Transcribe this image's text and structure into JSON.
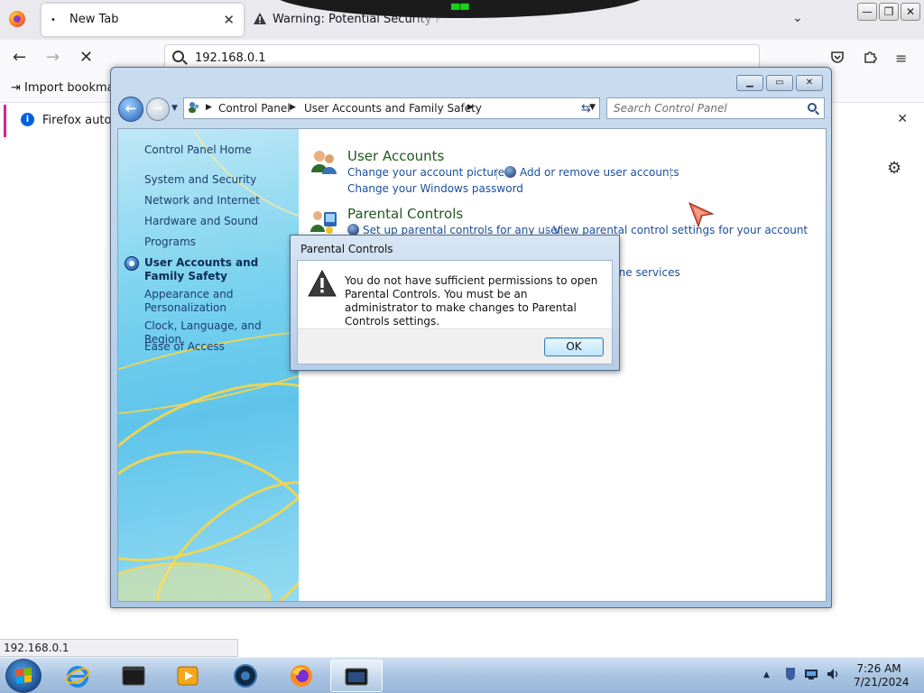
{
  "browser": {
    "tabs": [
      {
        "label": "New Tab",
        "active": true,
        "indicator": "•"
      },
      {
        "label": "Warning: Potential Security Ri",
        "active": false
      }
    ],
    "url": "192.168.0.1",
    "bookmark_label": "Import bookmark",
    "notice_text": "Firefox automa",
    "status_text": "192.168.0.1"
  },
  "control_panel": {
    "breadcrumb": [
      "Control Panel",
      "User Accounts and Family Safety"
    ],
    "search_placeholder": "Search Control Panel",
    "nav": {
      "home": "Control Panel Home",
      "items": [
        "System and Security",
        "Network and Internet",
        "Hardware and Sound",
        "Programs",
        "User Accounts and Family Safety",
        "Appearance and Personalization",
        "Clock, Language, and Region",
        "Ease of Access"
      ],
      "selected_index": 4
    },
    "categories": {
      "user_accounts": {
        "title": "User Accounts",
        "links": [
          "Change your account picture",
          "Add or remove user accounts",
          "Change your Windows password"
        ]
      },
      "parental_controls": {
        "title": "Parental Controls",
        "links": [
          "Set up parental controls for any user",
          "View parental control settings for your account"
        ]
      },
      "partial_link": "line services"
    }
  },
  "dialog": {
    "title": "Parental Controls",
    "message": "You do not have sufficient permissions to open Parental Controls. You must be an administrator to make changes to Parental Controls settings.",
    "ok_label": "OK"
  },
  "taskbar": {
    "time": "7:26 AM",
    "date": "7/21/2024"
  },
  "colors": {
    "link": "#1a4f9c",
    "category_title": "#1e5a1e",
    "nav_gradient": "#5fc4ea",
    "notice_accent": "#e0218a"
  }
}
